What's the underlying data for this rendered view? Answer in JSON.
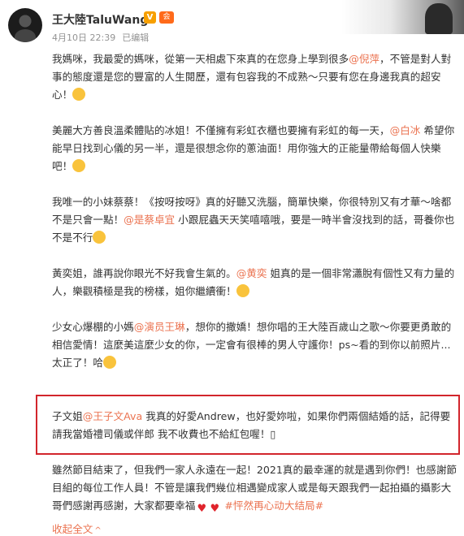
{
  "header": {
    "username": "王大陸TaluWang",
    "verified_badge": "V",
    "member_badge": "会",
    "date": "4月10日 22:39",
    "edited": "已编辑"
  },
  "post": {
    "paragraphs": [
      {
        "segments": [
          {
            "t": "text",
            "v": "我媽咪，我最愛的媽咪，從第一天相處下來真的在您身上學到很多"
          },
          {
            "t": "mention",
            "v": "@倪萍"
          },
          {
            "t": "text",
            "v": "，不管是對人對事的態度還是您的豐富的人生閱歷，還有包容我的不成熟～只要有您在身邊我真的超安心！"
          },
          {
            "t": "emoji",
            "v": "smile-emoji"
          }
        ]
      },
      {
        "segments": [
          {
            "t": "text",
            "v": "美麗大方善良溫柔體貼的冰姐！不僅擁有彩虹衣櫃也要擁有彩虹的每一天，"
          },
          {
            "t": "mention",
            "v": "@白冰"
          },
          {
            "t": "text",
            "v": " 希望你能早日找到心儀的另一半，還是很想念你的蔥油面！用你強大的正能量帶給每個人快樂吧！"
          },
          {
            "t": "emoji",
            "v": "grin-emoji"
          }
        ]
      },
      {
        "segments": [
          {
            "t": "text",
            "v": "我唯一的小妹蔡蔡！《按呀按呀》真的好聽又洗腦，簡單快樂，你很特別又有才華～啥都不是只會一點！"
          },
          {
            "t": "mention",
            "v": "@是蔡卓宜"
          },
          {
            "t": "text",
            "v": " 小跟屁蟲天天笑嘻嘻哦，要是一時半會沒找到的話，哥養你也不是不行"
          },
          {
            "t": "emoji",
            "v": "cool-emoji"
          }
        ]
      },
      {
        "segments": [
          {
            "t": "text",
            "v": "黃奕姐，誰再說你眼光不好我會生氣的。"
          },
          {
            "t": "mention",
            "v": "@黄奕"
          },
          {
            "t": "text",
            "v": " 姐真的是一個非常瀟脫有個性又有力量的人，樂觀積極是我的榜樣，姐你繼續衝！"
          },
          {
            "t": "emoji",
            "v": "smile-emoji"
          }
        ]
      },
      {
        "segments": [
          {
            "t": "text",
            "v": "少女心爆棚的小媽"
          },
          {
            "t": "mention",
            "v": "@演员王琳"
          },
          {
            "t": "text",
            "v": "，想你的撒嬌！想你唱的王大陸百歲山之歌～你要更勇敢的相信愛情！這麼美這麼少女的你，一定會有很棒的男人守護你！ps~看的到你以前照片...太正了！哈"
          },
          {
            "t": "emoji",
            "v": "heart-eyes-emoji"
          }
        ]
      },
      {
        "segments": [
          {
            "t": "text",
            "v": "子文姐"
          },
          {
            "t": "mention",
            "v": "@王子文Ava"
          },
          {
            "t": "text",
            "v": " 我真的好愛Andrew，也好愛妳啦，如果你們兩個結婚的話，記得要請我當婚禮司儀或伴郎 我不收費也不給紅包喔！▯"
          }
        ]
      },
      {
        "segments": [
          {
            "t": "text",
            "v": "雖然節目結束了，但我們一家人永遠在一起！2021真的最幸運的就是遇到你們！也感謝節目組的每位工作人員！不管是讓我們幾位相遇變成家人或是每天跟我們一起拍攝的攝影大哥們感謝再感謝，大家都要幸福"
          },
          {
            "t": "emoji",
            "v": "red-heart-emoji"
          },
          {
            "t": "emoji",
            "v": "red-heart-emoji"
          },
          {
            "t": "text",
            "v": " "
          },
          {
            "t": "hashtag",
            "v": "#怦然再心动大结局#"
          }
        ]
      }
    ],
    "expand_label": "收起全文",
    "expand_chevron": "^"
  },
  "colors": {
    "mention": "#eb7350",
    "highlight_box": "#d2252c",
    "meta_text": "#939393",
    "body_text": "#333333"
  }
}
